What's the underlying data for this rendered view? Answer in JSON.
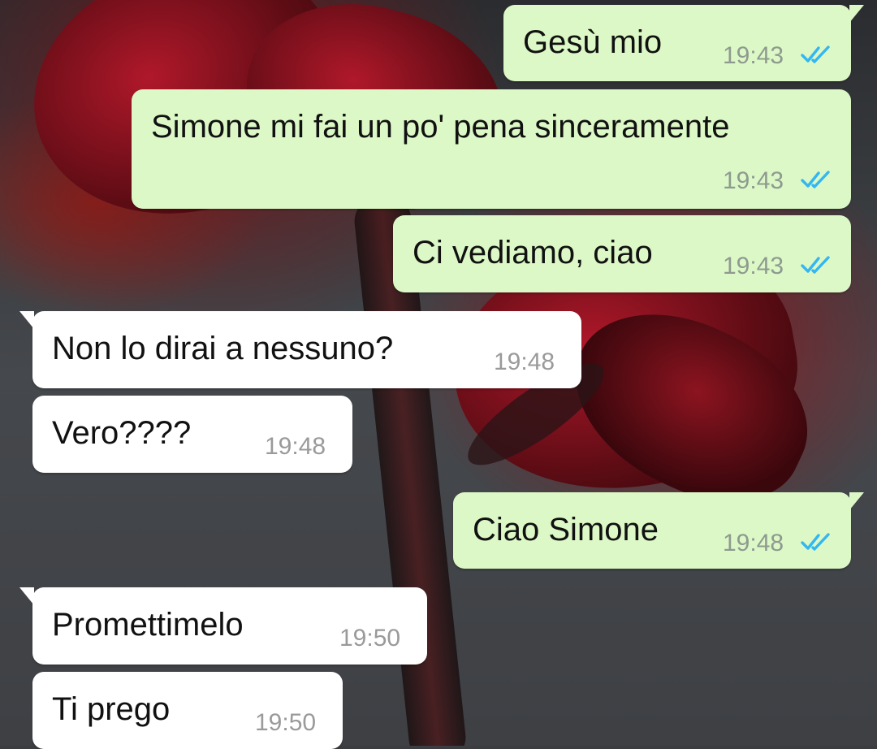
{
  "colors": {
    "outgoing_bubble": "#dcf8c6",
    "incoming_bubble": "#ffffff",
    "read_ticks": "#34b7f1"
  },
  "messages": [
    {
      "direction": "outgoing",
      "text": "Gesù mio",
      "time": "19:43",
      "status_icon": "double-check-read-icon"
    },
    {
      "direction": "outgoing",
      "text": "Simone mi fai un po' pena sinceramente",
      "time": "19:43",
      "status_icon": "double-check-read-icon"
    },
    {
      "direction": "outgoing",
      "text": "Ci vediamo, ciao",
      "time": "19:43",
      "status_icon": "double-check-read-icon"
    },
    {
      "direction": "incoming",
      "text": "Non lo dirai a nessuno?",
      "time": "19:48"
    },
    {
      "direction": "incoming",
      "text": "Vero????",
      "time": "19:48"
    },
    {
      "direction": "outgoing",
      "text": "Ciao Simone",
      "time": "19:48",
      "status_icon": "double-check-read-icon"
    },
    {
      "direction": "incoming",
      "text": "Promettimelo",
      "time": "19:50"
    },
    {
      "direction": "incoming",
      "text": "Ti prego",
      "time": "19:50"
    }
  ]
}
